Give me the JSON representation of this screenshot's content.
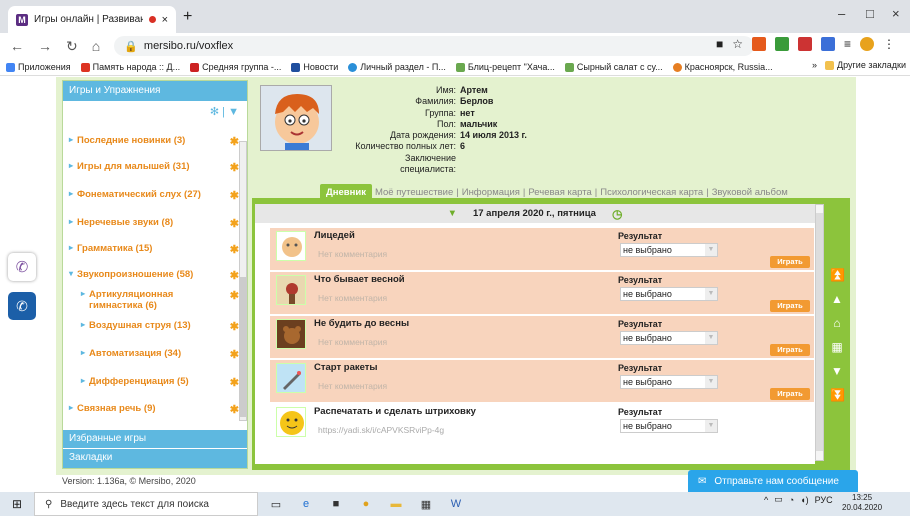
{
  "browser": {
    "tab_title": "Игры онлайн | Развивающ...",
    "tab_close": "×",
    "new_tab": "+",
    "url": "mersibo.ru/voxflex",
    "window": {
      "minimize": "–",
      "maximize": "□",
      "close": "×"
    },
    "bookmarks": [
      "Приложения",
      "Память народа :: Д...",
      "Средняя группа -...",
      "Новости",
      "Личный раздел - П...",
      "Блиц-рецепт \"Хача...",
      "Сырный салат с су...",
      "Красноярск, Russia..."
    ],
    "bookmarks_more": "»",
    "other_bookmarks": "Другие закладки"
  },
  "sidebar": {
    "header": "Игры и Упражнения",
    "items": [
      {
        "label": "Последние новинки (3)",
        "expanded": false
      },
      {
        "label": "Игры для малышей (31)",
        "expanded": false
      },
      {
        "label": "Фонематический слух (27)",
        "expanded": false
      },
      {
        "label": "Неречевые звуки (8)",
        "expanded": false
      },
      {
        "label": "Грамматика (15)",
        "expanded": false
      },
      {
        "label": "Звукопроизношение (58)",
        "expanded": true
      },
      {
        "label": "Артикуляционная гимнастика (6)",
        "expanded": false
      },
      {
        "label": "Воздушная струя (13)",
        "expanded": false
      },
      {
        "label": "Автоматизация (34)",
        "expanded": false
      },
      {
        "label": "Дифференциация (5)",
        "expanded": false
      },
      {
        "label": "Связная речь (9)",
        "expanded": false
      }
    ],
    "favorites": "Избранные игры",
    "bookmarks": "Закладки"
  },
  "version": "Version: 1.136a, © Mersibo, 2020",
  "profile": {
    "labels": [
      "Имя:",
      "Фамилия:",
      "Группа:",
      "Пол:",
      "Дата рождения:",
      "Количество полных лет:",
      "Заключение специалиста:"
    ],
    "values": [
      "Артем",
      "Берлов",
      "нет",
      "мальчик",
      "14 июля 2013 г.",
      "6",
      ""
    ]
  },
  "tabs": [
    "Дневник",
    "Моё путешествие",
    "Информация",
    "Речевая карта",
    "Психологическая карта",
    "Звуковой альбом"
  ],
  "date": "17 апреля 2020 г., пятница",
  "result_label": "Результат",
  "games": [
    {
      "name": "Лицедей",
      "comment": "Нет комментария",
      "result": "не выбрано",
      "play": "Играть"
    },
    {
      "name": "Что бывает весной",
      "comment": "Нет комментария",
      "result": "не выбрано",
      "play": "Играть"
    },
    {
      "name": "Не будить до весны",
      "comment": "Нет комментария",
      "result": "не выбрано",
      "play": "Играть"
    },
    {
      "name": "Старт ракеты",
      "comment": "Нет комментария",
      "result": "не выбрано",
      "play": "Играть"
    },
    {
      "name": "Распечатать и сделать штриховку",
      "comment": "https://yadi.sk/i/cAPVKSRviPp-4g",
      "result": "не выбрано",
      "play": ""
    }
  ],
  "chat": "Отправьте нам сообщение",
  "taskbar": {
    "search_placeholder": "Введите здесь текст для поиска",
    "lang": "РУС",
    "time": "13:25",
    "date": "20.04.2020"
  }
}
